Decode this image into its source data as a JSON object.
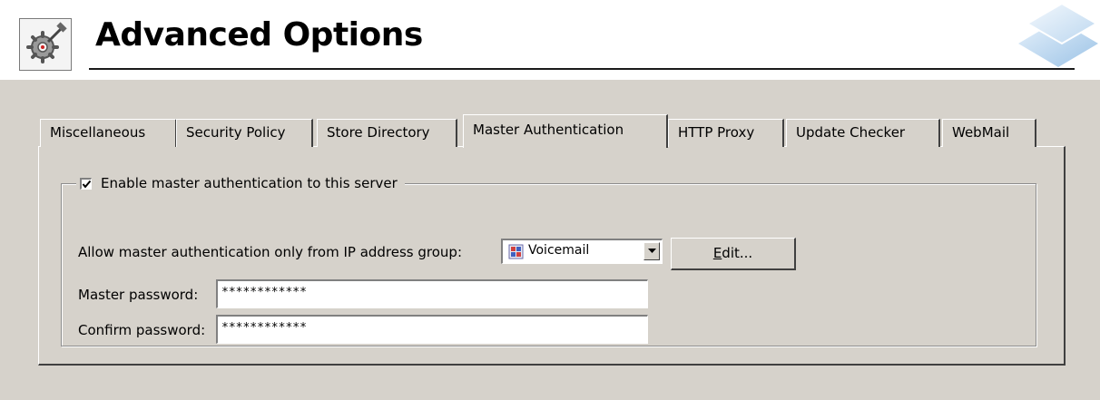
{
  "header": {
    "title": "Advanced Options",
    "app_icon": "gear-hammer-icon",
    "corner_logo": "stacked-squares-logo"
  },
  "tabs": [
    {
      "label": "Miscellaneous",
      "active": false
    },
    {
      "label": "Security Policy",
      "active": false
    },
    {
      "label": "Store Directory",
      "active": false
    },
    {
      "label": "Master Authentication",
      "active": true
    },
    {
      "label": "HTTP Proxy",
      "active": false
    },
    {
      "label": "Update Checker",
      "active": false
    },
    {
      "label": "WebMail",
      "active": false
    }
  ],
  "master_auth": {
    "enable_label": "Enable master authentication to this server",
    "enabled": true,
    "ip_group_label": "Allow master authentication only from IP address group:",
    "ip_group_value": "Voicemail",
    "ip_group_icon": "ip-group-icon",
    "edit_button_label": "Edit...",
    "edit_button_mnemonic": "E",
    "edit_button_rest": "dit...",
    "master_password_label": "Master password:",
    "master_password_value": "************",
    "confirm_password_label": "Confirm password:",
    "confirm_password_value": "************"
  },
  "colors": {
    "panel_bg": "#d6d2cb",
    "header_bg": "#ffffff"
  }
}
